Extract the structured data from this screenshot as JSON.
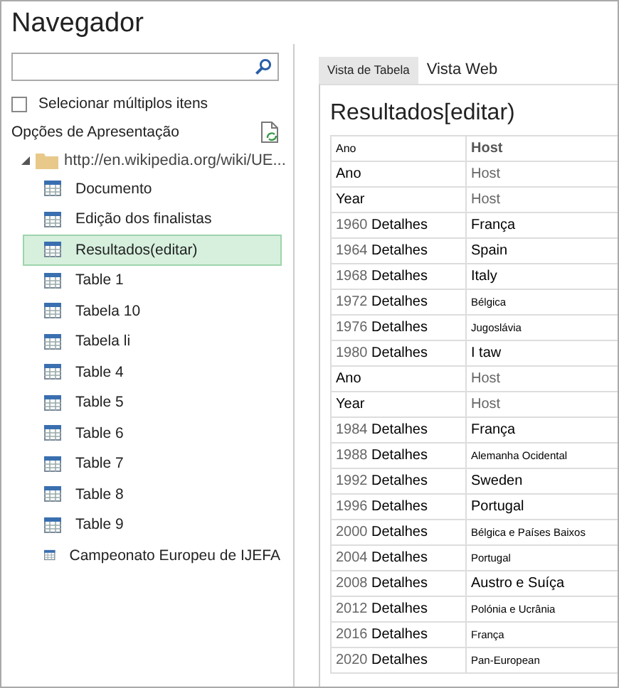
{
  "window": {
    "title": "Navegador"
  },
  "multi_select": {
    "label": "Selecionar múltiplos itens",
    "checked": false
  },
  "display_options": {
    "label": "Opções de Apresentação"
  },
  "tree": {
    "label": "http://en.wikipedia.org/wiki/UE...",
    "expanded": true,
    "children": [
      {
        "label": "Documento",
        "selected": false
      },
      {
        "label": "Edição dos finalistas",
        "selected": false
      },
      {
        "label": "Resultados(editar)",
        "selected": true
      },
      {
        "label": "Table 1",
        "selected": false
      },
      {
        "label": "Tabela 10",
        "selected": false
      },
      {
        "label": "Tabela li",
        "selected": false
      },
      {
        "label": "Table 4",
        "selected": false
      },
      {
        "label": "Table 5",
        "selected": false
      },
      {
        "label": "Table 6",
        "selected": false
      },
      {
        "label": "Table 7",
        "selected": false
      },
      {
        "label": "Table 8",
        "selected": false
      },
      {
        "label": "Table 9",
        "selected": false
      },
      {
        "label": "Campeonato Europeu de IJEFA",
        "selected": false
      }
    ]
  },
  "tabs": [
    {
      "label": "Vista de Tabela",
      "selected": true
    },
    {
      "label": "Vista Web",
      "selected": false
    }
  ],
  "preview": {
    "title": "Resultados[editar)",
    "table": {
      "columns": [
        "Ano",
        "Host"
      ],
      "rows": [
        {
          "kind": "header",
          "year": "Ano",
          "host": "Host"
        },
        {
          "kind": "header",
          "year": "Year",
          "host": "Host"
        },
        {
          "kind": "data",
          "year": "1960",
          "detail": "Detalhes",
          "host": "França"
        },
        {
          "kind": "data",
          "year": "1964",
          "detail": "Detalhes",
          "host": "Spain"
        },
        {
          "kind": "data",
          "year": "1968",
          "detail": "Detalhes",
          "host": "Italy"
        },
        {
          "kind": "data",
          "year": "1972",
          "detail": "Detalhes",
          "host": "Bélgica",
          "small": true
        },
        {
          "kind": "data",
          "year": "1976",
          "detail": "Detalhes",
          "host": "Jugoslávia",
          "small": true
        },
        {
          "kind": "data",
          "year": "1980",
          "detail": "Detalhes",
          "host": "I taw"
        },
        {
          "kind": "header",
          "year": "Ano",
          "host": "Host"
        },
        {
          "kind": "header",
          "year": "Year",
          "host": "Host"
        },
        {
          "kind": "data",
          "year": "1984",
          "detail": "Detalhes",
          "host": "França"
        },
        {
          "kind": "data",
          "year": "1988",
          "detail": "Detalhes",
          "host": "Alemanha Ocidental",
          "small": true
        },
        {
          "kind": "data",
          "year": "1992",
          "detail": "Detalhes",
          "host": "Sweden"
        },
        {
          "kind": "data",
          "year": "1996",
          "detail": "Detalhes",
          "host": "Portugal"
        },
        {
          "kind": "data",
          "year": "2000",
          "detail": "Detalhes",
          "host": "Bélgica e Países Baixos",
          "small": true
        },
        {
          "kind": "data",
          "year": "2004",
          "detail": "Detalhes",
          "host": "Portugal",
          "small": true
        },
        {
          "kind": "data",
          "year": "2008",
          "detail": "Detalhes",
          "host": "Austro e Suíça"
        },
        {
          "kind": "data",
          "year": "2012",
          "detail": "Detalhes",
          "host": "Polónia e Ucrânia",
          "small": true
        },
        {
          "kind": "data",
          "year": "2016",
          "detail": "Detalhes",
          "host": "França",
          "small": true
        },
        {
          "kind": "data",
          "year": "2020",
          "detail": "Detalhes",
          "host": "Pan-European",
          "small": true
        }
      ]
    }
  }
}
